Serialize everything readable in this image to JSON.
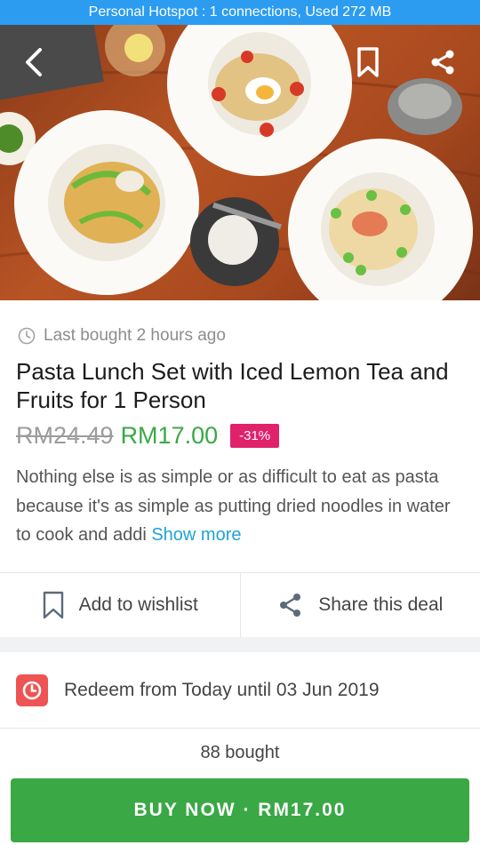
{
  "status_bar": {
    "text": "Personal Hotspot : 1 connections, Used 272 MB"
  },
  "deal": {
    "last_bought": "Last bought 2 hours ago",
    "title": "Pasta Lunch Set with Iced Lemon Tea and Fruits for 1 Person",
    "old_price": "RM24.49",
    "new_price": "RM17.00",
    "discount": "-31%",
    "description": "Nothing else is as simple or as difficult to eat as pasta because it's as simple as putting dried noodles in water to cook and addi",
    "show_more": "Show more"
  },
  "actions": {
    "wishlist": "Add to wishlist",
    "share": "Share this deal"
  },
  "redeem": {
    "text": "Redeem from Today until 03 Jun 2019"
  },
  "purchase": {
    "bought_count": "88 bought",
    "buy_label": "BUY NOW · RM17.00"
  },
  "icons": {
    "back": "chevron-left-icon",
    "bookmark": "bookmark-icon",
    "share": "share-icon",
    "clock": "clock-icon",
    "calendar": "calendar-clock-icon"
  },
  "colors": {
    "status_bar": "#2b9cf0",
    "primary_green": "#3aa845",
    "discount_pink": "#e0226b",
    "link_blue": "#1fa3d6",
    "redeem_red": "#ee5454"
  }
}
